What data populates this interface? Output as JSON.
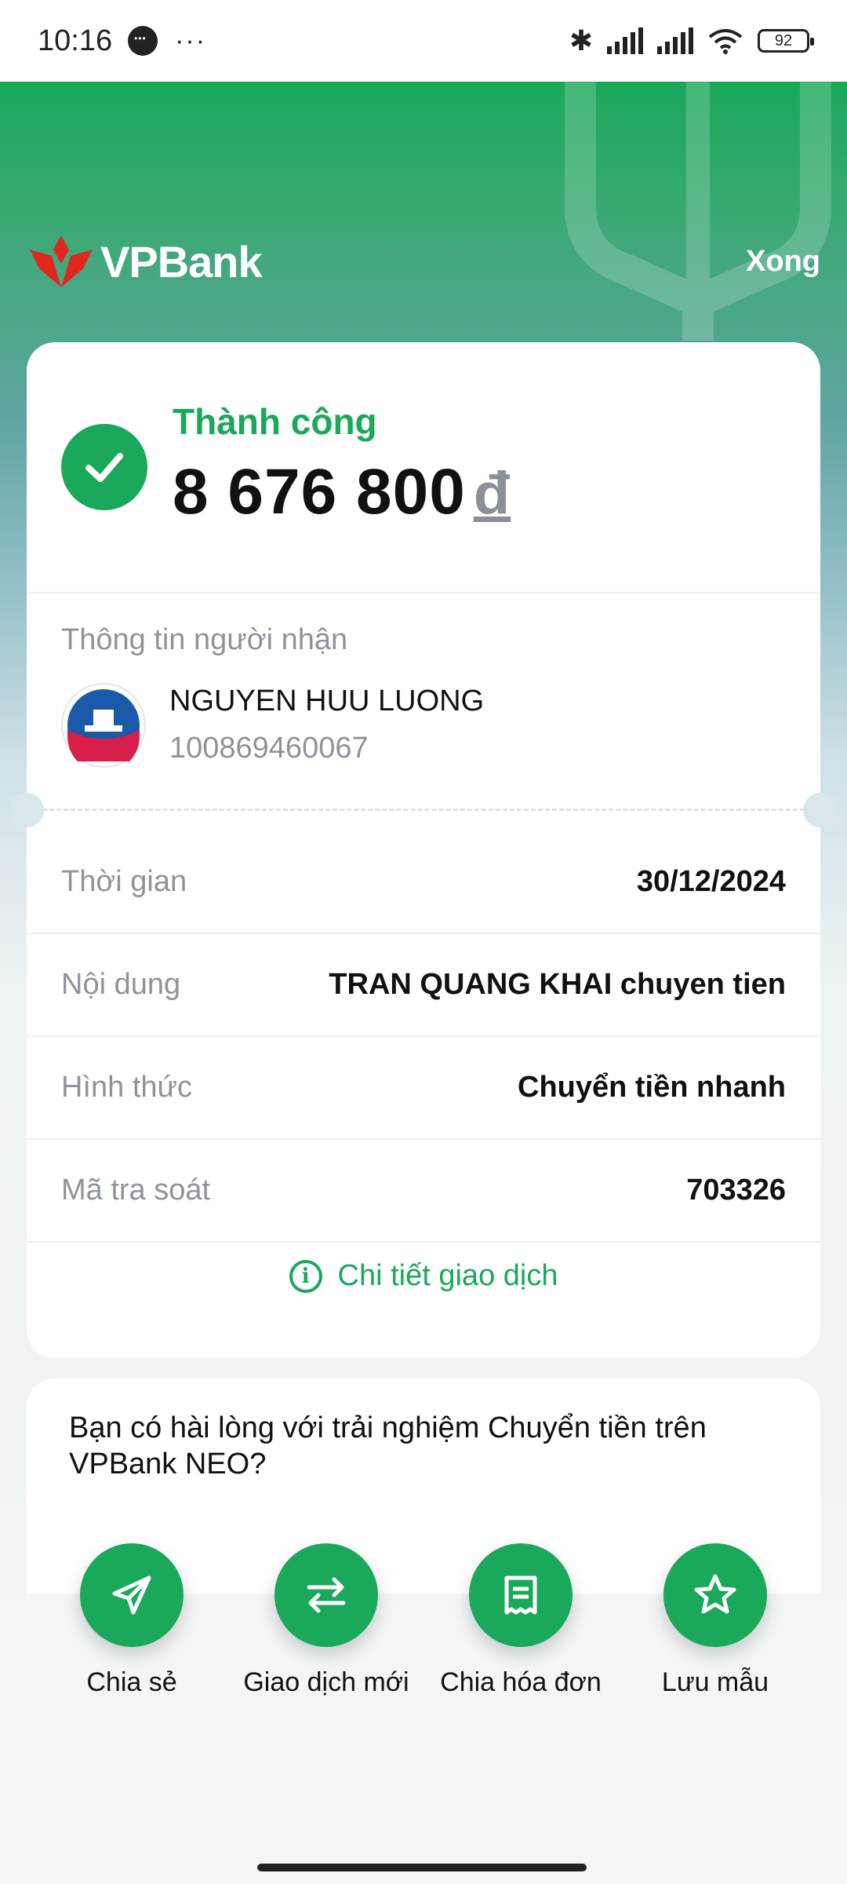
{
  "status_bar": {
    "time": "10:16",
    "battery": "92"
  },
  "header": {
    "brand": "VPBank",
    "done_label": "Xong"
  },
  "result": {
    "status": "Thành công",
    "amount": "8 676 800",
    "currency": "đ"
  },
  "recipient": {
    "title": "Thông tin người nhận",
    "name": "NGUYEN HUU LUONG",
    "account": "100869460067"
  },
  "details": [
    {
      "label": "Thời gian",
      "value": "30/12/2024"
    },
    {
      "label": "Nội dung",
      "value": "TRAN QUANG KHAI chuyen tien"
    },
    {
      "label": "Hình thức",
      "value": "Chuyển tiền nhanh"
    },
    {
      "label": "Mã tra soát",
      "value": "703326"
    }
  ],
  "detail_link": "Chi tiết giao dịch",
  "survey": {
    "question": "Bạn có hài lòng với trải nghiệm Chuyển tiền trên VPBank NEO?"
  },
  "actions": [
    {
      "label": "Chia sẻ",
      "icon": "send-icon"
    },
    {
      "label": "Giao dịch mới",
      "icon": "swap-icon"
    },
    {
      "label": "Chia hóa đơn",
      "icon": "bill-icon"
    },
    {
      "label": "Lưu mẫu",
      "icon": "star-icon"
    }
  ],
  "colors": {
    "accent": "#1aa85a",
    "logo_red": "#e0261f"
  }
}
